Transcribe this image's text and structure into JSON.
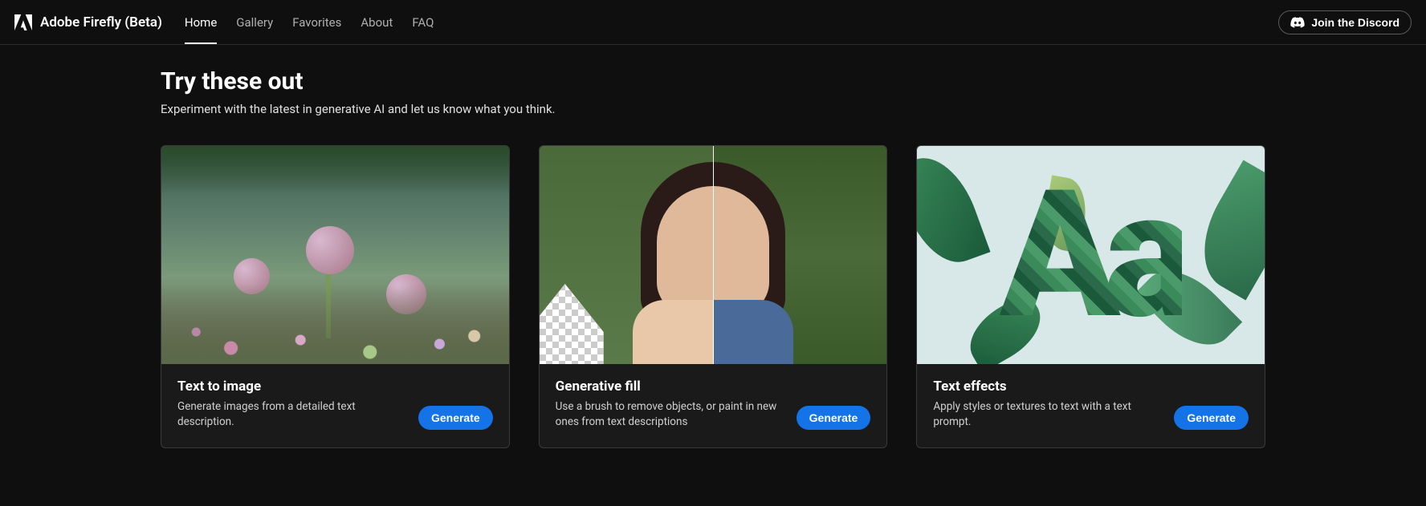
{
  "header": {
    "app_name": "Adobe Firefly (Beta)",
    "nav": [
      "Home",
      "Gallery",
      "Favorites",
      "About",
      "FAQ"
    ],
    "active_nav_index": 0,
    "discord_label": "Join the Discord"
  },
  "section": {
    "title": "Try these out",
    "subtitle": "Experiment with the latest in generative AI and let us know what you think."
  },
  "cards": [
    {
      "title": "Text to image",
      "description": "Generate images from a detailed text description.",
      "button": "Generate"
    },
    {
      "title": "Generative fill",
      "description": "Use a brush to remove objects, or paint in new ones from text descriptions",
      "button": "Generate"
    },
    {
      "title": "Text effects",
      "description": "Apply styles or textures to text with a text prompt.",
      "button": "Generate"
    }
  ]
}
